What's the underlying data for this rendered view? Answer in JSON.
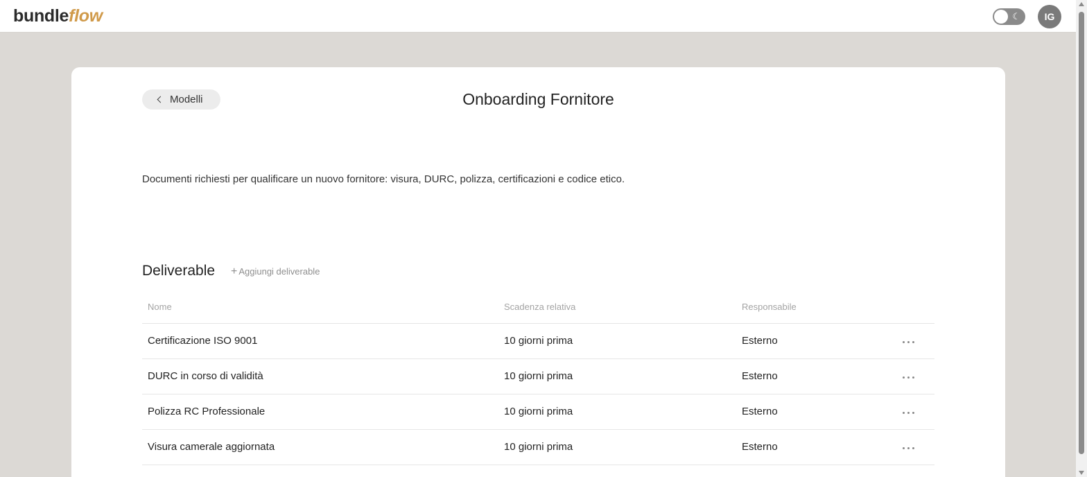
{
  "header": {
    "logo_part1": "bundle",
    "logo_part2": "flow",
    "theme_toggle_icon": "moon-icon",
    "avatar_initials": "IG"
  },
  "page": {
    "back_label": "Modelli",
    "title": "Onboarding Fornitore",
    "description": "Documenti richiesti per qualificare un nuovo fornitore: visura, DURC, polizza, certificazioni e codice etico."
  },
  "deliverables": {
    "section_title": "Deliverable",
    "add_label": "Aggiungi deliverable",
    "columns": [
      "Nome",
      "Scadenza relativa",
      "Responsabile"
    ],
    "rows": [
      {
        "name": "Certificazione ISO 9001",
        "deadline": "10 giorni prima",
        "owner": "Esterno"
      },
      {
        "name": "DURC in corso di validità",
        "deadline": "10 giorni prima",
        "owner": "Esterno"
      },
      {
        "name": "Polizza RC Professionale",
        "deadline": "10 giorni prima",
        "owner": "Esterno"
      },
      {
        "name": "Visura camerale aggiornata",
        "deadline": "10 giorni prima",
        "owner": "Esterno"
      }
    ]
  },
  "colors": {
    "page_background": "#dcd9d5",
    "brand_accent": "#d09a4a",
    "avatar_background": "#7a7a7a"
  }
}
